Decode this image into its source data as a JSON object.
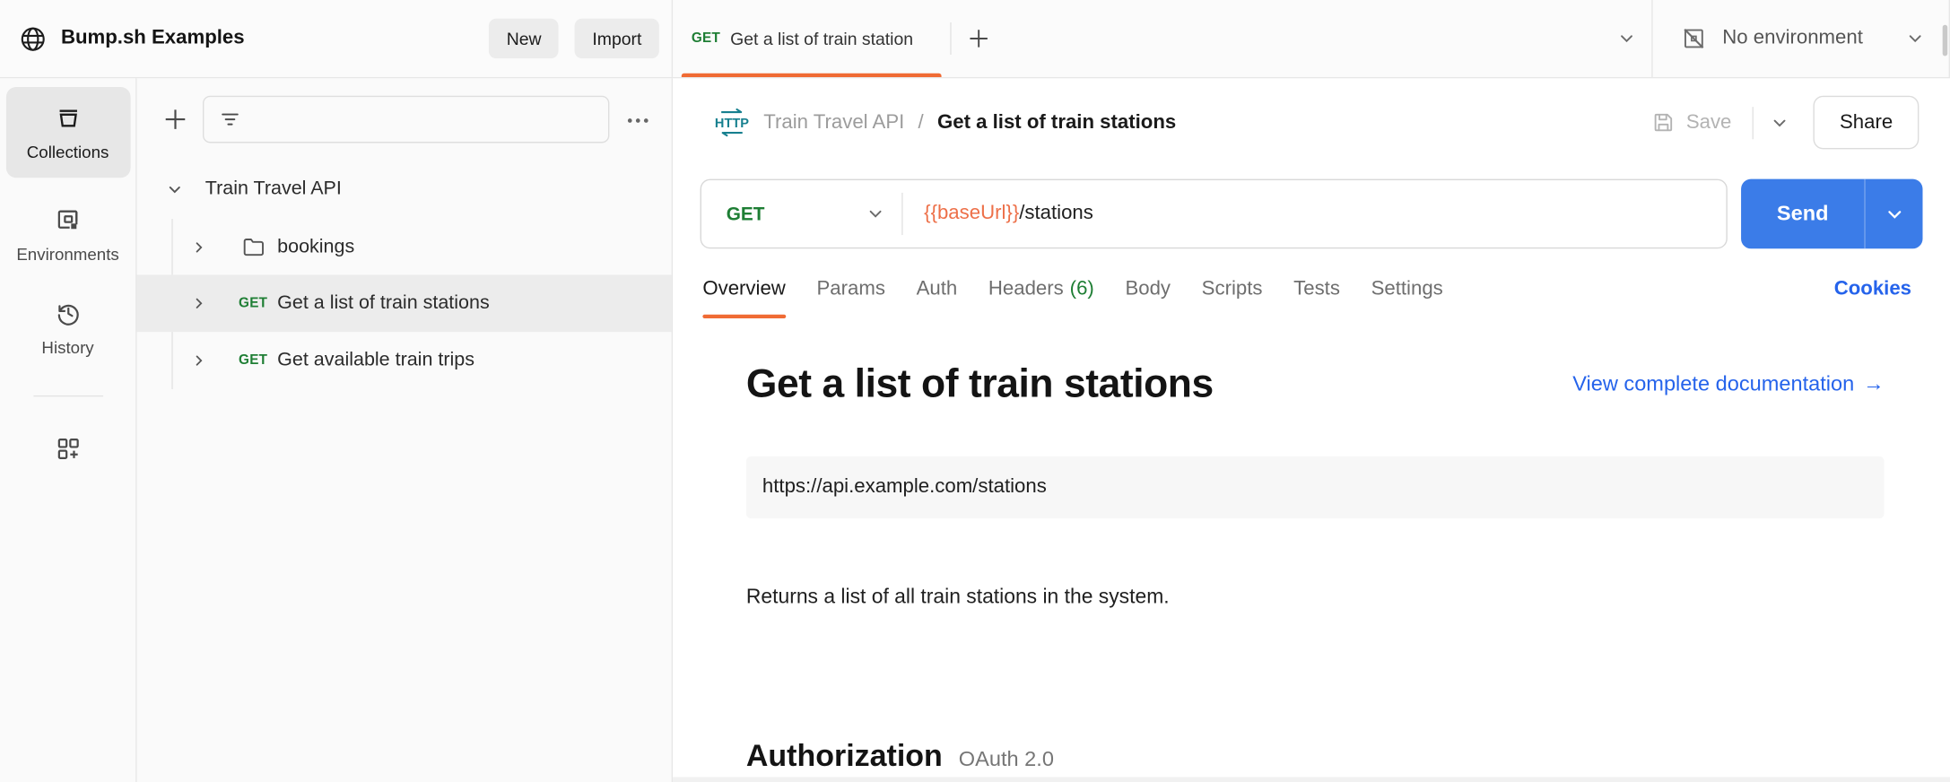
{
  "workspace": {
    "title": "Bump.sh Examples",
    "new_label": "New",
    "import_label": "Import"
  },
  "tab_strip": {
    "active_tab": {
      "method": "GET",
      "title": "Get a list of train station"
    }
  },
  "environment": {
    "label": "No environment"
  },
  "rail": {
    "items": [
      {
        "label": "Collections",
        "active": true
      },
      {
        "label": "Environments",
        "active": false
      },
      {
        "label": "History",
        "active": false
      }
    ]
  },
  "sidebar": {
    "root": {
      "label": "Train Travel API"
    },
    "items": [
      {
        "kind": "folder",
        "label": "bookings"
      },
      {
        "kind": "request",
        "method": "GET",
        "label": "Get a list of train stations",
        "selected": true
      },
      {
        "kind": "request",
        "method": "GET",
        "label": "Get available train trips",
        "selected": false
      }
    ]
  },
  "header": {
    "http_badge": "HTTP",
    "breadcrumb": {
      "root": "Train Travel API",
      "separator": "/",
      "current": "Get a list of train stations"
    },
    "save_label": "Save",
    "share_label": "Share"
  },
  "request": {
    "method": "GET",
    "url_variable": "{{baseUrl}}",
    "url_path": "/stations",
    "send_label": "Send"
  },
  "request_tabs": {
    "items": [
      {
        "label": "Overview",
        "active": true
      },
      {
        "label": "Params",
        "active": false
      },
      {
        "label": "Auth",
        "active": false
      },
      {
        "label": "Headers",
        "count": "(6)",
        "active": false
      },
      {
        "label": "Body",
        "active": false
      },
      {
        "label": "Scripts",
        "active": false
      },
      {
        "label": "Tests",
        "active": false
      },
      {
        "label": "Settings",
        "active": false
      }
    ],
    "cookies_label": "Cookies"
  },
  "overview": {
    "title": "Get a list of train stations",
    "doc_link_label": "View complete documentation",
    "doc_link_arrow": "→",
    "endpoint": "https://api.example.com/stations",
    "description": "Returns a list of all train stations in the system.",
    "authorization": {
      "title": "Authorization",
      "type": "OAuth 2.0"
    }
  },
  "colors": {
    "accent_orange": "#F06B34",
    "method_get_green": "#1E7E34",
    "send_blue": "#3B7CE8",
    "link_blue": "#2563EB",
    "http_teal": "#17808F"
  }
}
